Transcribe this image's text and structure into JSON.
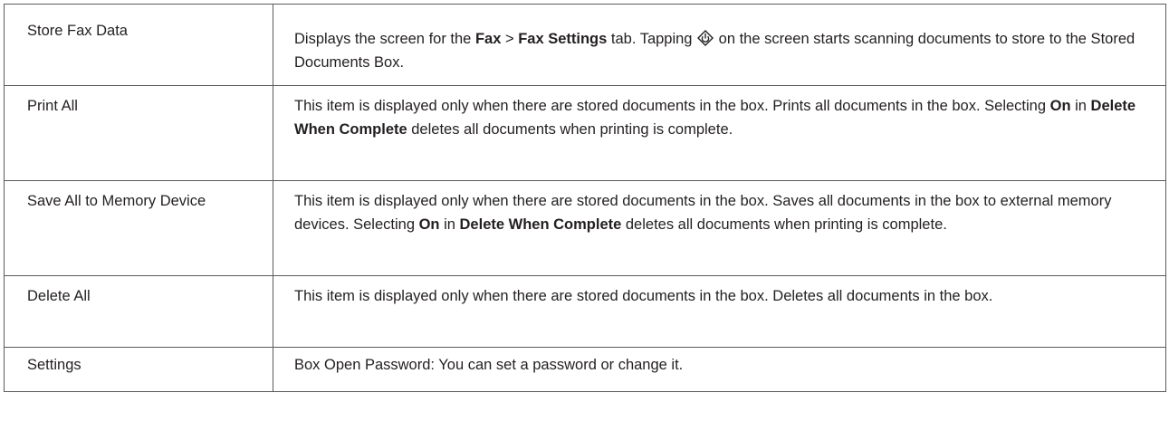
{
  "rows": [
    {
      "name": "Store Fax Data",
      "desc": {
        "p1": "Displays the screen for the ",
        "b1": "Fax",
        "p2": " > ",
        "b2": "Fax Settings",
        "p3": " tab. Tapping ",
        "icon": "start-icon",
        "p4": " on the screen starts scanning documents to store to the Stored Documents Box."
      }
    },
    {
      "name": "Print All",
      "desc": {
        "p1": "This item is displayed only when there are stored documents in the box. Prints all documents in the box. Selecting ",
        "b1": "On",
        "p2": " in ",
        "b2": "Delete When Complete",
        "p3": " deletes all documents when printing is complete."
      }
    },
    {
      "name": "Save All to Memory Device",
      "desc": {
        "p1": "This item is displayed only when there are stored documents in the box. Saves all documents in the box to external memory devices. Selecting ",
        "b1": "On",
        "p2": " in ",
        "b2": "Delete When Complete",
        "p3": " deletes all documents when printing is complete."
      }
    },
    {
      "name": "Delete All",
      "desc": {
        "p1": "This item is displayed only when there are stored documents in the box. Deletes all documents in the box."
      }
    },
    {
      "name": "Settings",
      "desc": {
        "p1": "Box Open Password: You can set a password or change it."
      }
    }
  ]
}
